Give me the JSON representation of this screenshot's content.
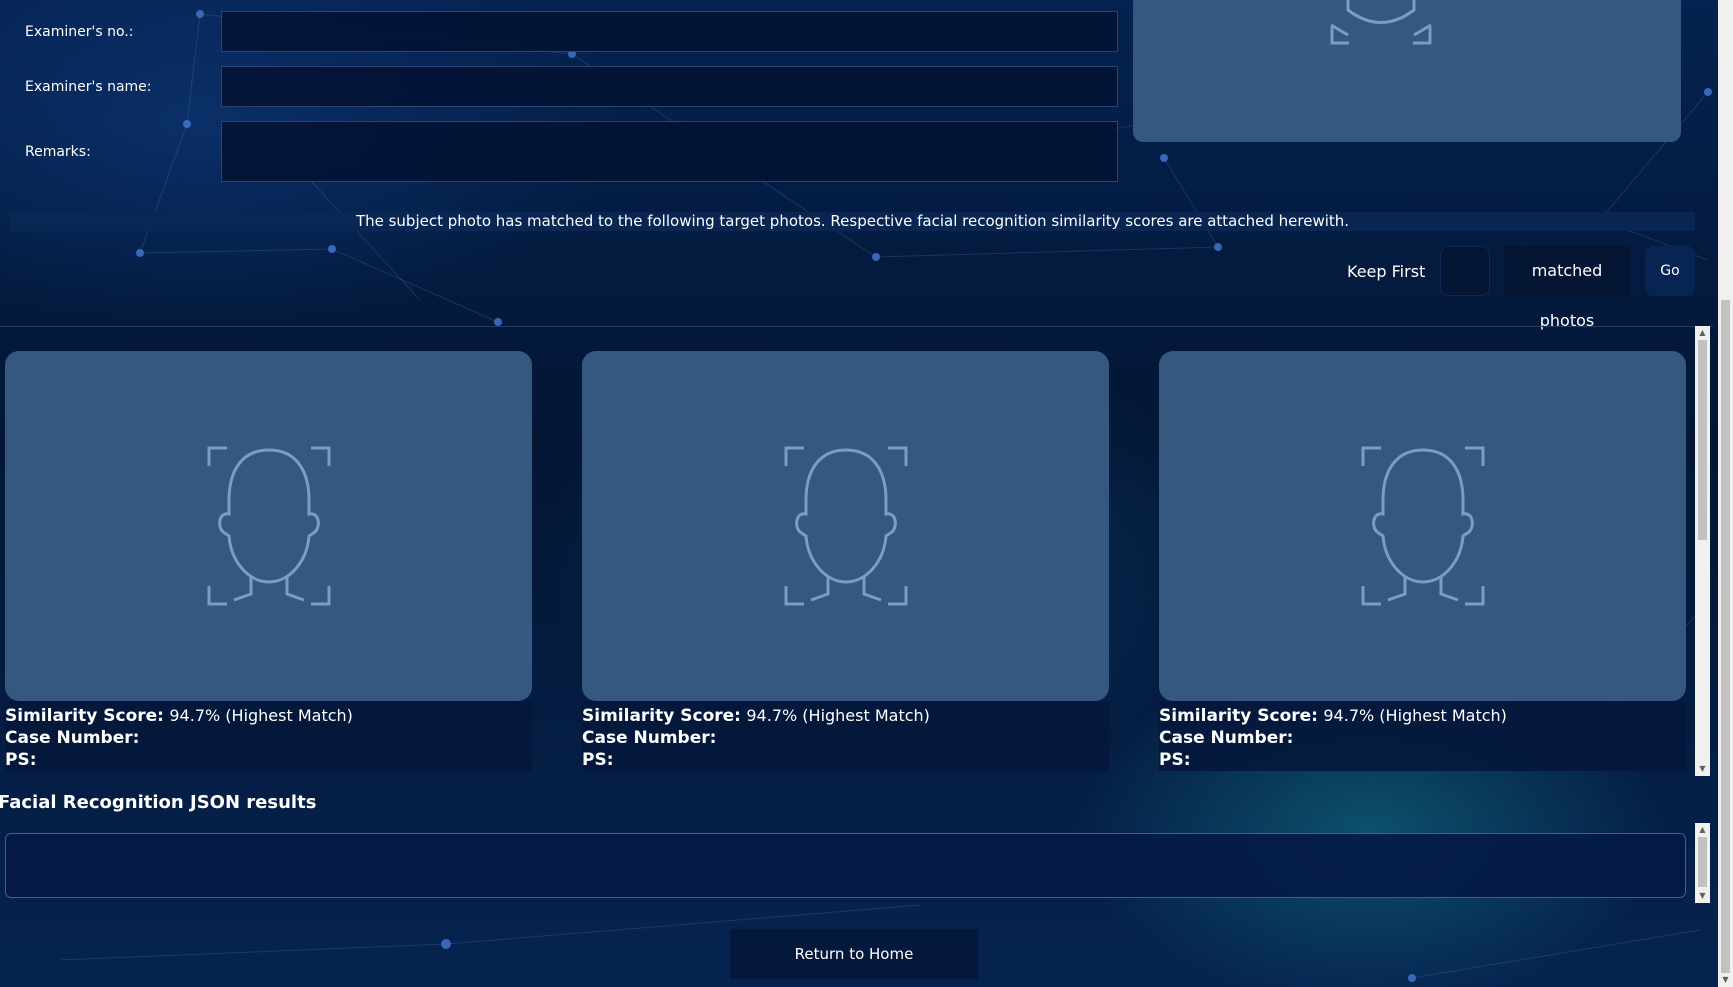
{
  "form": {
    "examiner_no_label": "Examiner's no.:",
    "examiner_no_value": "",
    "examiner_name_label": "Examiner's name:",
    "examiner_name_value": "",
    "remarks_label": "Remarks:",
    "remarks_value": ""
  },
  "banner": {
    "text": "The subject photo has matched to the following target photos. Respective facial recognition similarity scores are attached herewith."
  },
  "filter": {
    "keep_first_label": "Keep First",
    "keep_first_value": "",
    "matched_photos_label": "matched photos",
    "go_label": "Go"
  },
  "matches": [
    {
      "score_label": "Similarity Score:",
      "score_value": "94.7% (Highest Match)",
      "case_label": "Case Number:",
      "case_value": "",
      "ps_label": "PS:",
      "ps_value": ""
    },
    {
      "score_label": "Similarity Score:",
      "score_value": "94.7% (Highest Match)",
      "case_label": "Case Number:",
      "case_value": "",
      "ps_label": "PS:",
      "ps_value": ""
    },
    {
      "score_label": "Similarity Score:",
      "score_value": "94.7% (Highest Match)",
      "case_label": "Case Number:",
      "case_value": "",
      "ps_label": "PS:",
      "ps_value": ""
    }
  ],
  "json_results": {
    "heading": "Facial Recognition JSON results",
    "value": ""
  },
  "footer": {
    "home_label": "Return to Home"
  },
  "icons": {
    "placeholder": "face-scan-icon",
    "scroll_up": "▲",
    "scroll_down": "▼"
  },
  "colors": {
    "background": "#041a38",
    "photo_placeholder": "#34587f",
    "icon_stroke": "#7d9cc2"
  }
}
